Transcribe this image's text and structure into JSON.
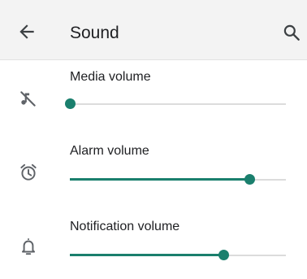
{
  "app_bar": {
    "title": "Sound",
    "back_icon": "arrow-back-icon",
    "search_icon": "search-icon"
  },
  "accent_color": "#1a7f6d",
  "volumes": [
    {
      "label": "Media volume",
      "icon": "media-muted-icon",
      "level": 0.0
    },
    {
      "label": "Alarm volume",
      "icon": "alarm-clock-icon",
      "level": 0.83
    },
    {
      "label": "Notification volume",
      "icon": "bell-icon",
      "level": 0.71
    }
  ]
}
